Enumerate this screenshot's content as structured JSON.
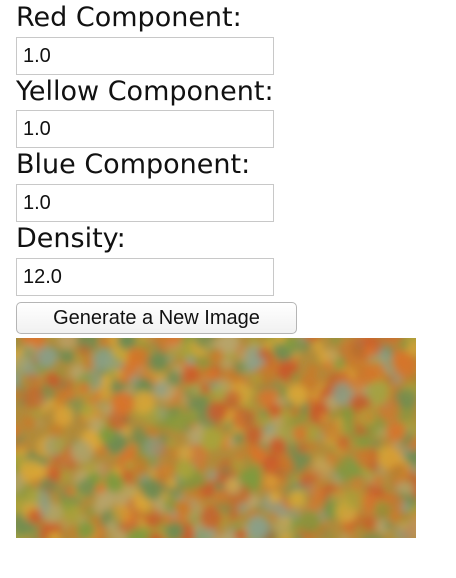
{
  "form": {
    "red_label": "Red Component:",
    "red_value": "1.0",
    "yellow_label": "Yellow Component:",
    "yellow_value": "1.0",
    "blue_label": "Blue Component:",
    "blue_value": "1.0",
    "density_label": "Density:",
    "density_value": "12.0",
    "generate_label": "Generate a New Image"
  },
  "image": {
    "palette": [
      "#c97a2a",
      "#d8742c",
      "#7f9a3e",
      "#a8a23a",
      "#8aa08a",
      "#d9a637",
      "#c85a2a",
      "#6e8c52",
      "#b7a46a"
    ]
  }
}
